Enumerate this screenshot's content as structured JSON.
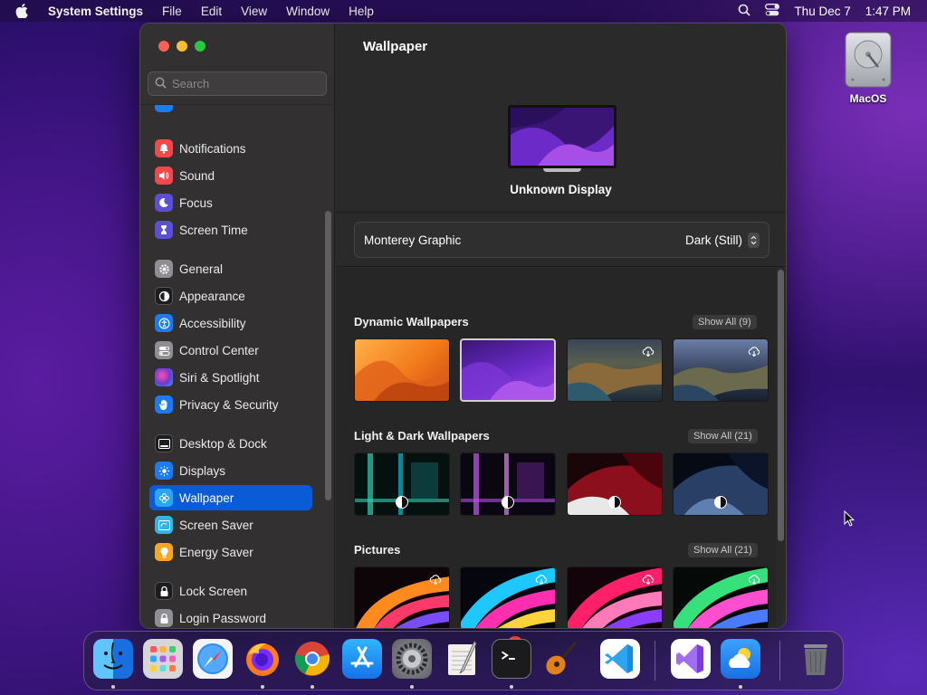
{
  "menubar": {
    "app_name": "System Settings",
    "menus": [
      "File",
      "Edit",
      "View",
      "Window",
      "Help"
    ],
    "date": "Thu Dec 7",
    "time": "1:47 PM"
  },
  "desktop": {
    "icons": [
      {
        "label": "MacOS",
        "icon": "hard-drive-icon"
      }
    ]
  },
  "window": {
    "search_placeholder": "Search",
    "sidebar": [
      {
        "label": "Notifications",
        "icon": "bell-icon",
        "color": "#f2474b"
      },
      {
        "label": "Sound",
        "icon": "speaker-icon",
        "color": "#f2474b"
      },
      {
        "label": "Focus",
        "icon": "moon-icon",
        "color": "#5a4fd6"
      },
      {
        "label": "Screen Time",
        "icon": "hourglass-icon",
        "color": "#5a4fd6"
      },
      {
        "label": "General",
        "icon": "gear-icon",
        "color": "#8e8e93"
      },
      {
        "label": "Appearance",
        "icon": "circle-half-icon",
        "color": "#1d1d1f"
      },
      {
        "label": "Accessibility",
        "icon": "accessibility-icon",
        "color": "#1a7bf2"
      },
      {
        "label": "Control Center",
        "icon": "toggles-icon",
        "color": "#8e8e93"
      },
      {
        "label": "Siri & Spotlight",
        "icon": "siri-icon",
        "color": "#b83ad9"
      },
      {
        "label": "Privacy & Security",
        "icon": "hand-icon",
        "color": "#1a7bf2"
      },
      {
        "label": "Desktop & Dock",
        "icon": "dock-icon",
        "color": "#1d1d1f"
      },
      {
        "label": "Displays",
        "icon": "sun-icon",
        "color": "#1a7bf2"
      },
      {
        "label": "Wallpaper",
        "icon": "flower-icon",
        "color": "#2aa6f5",
        "selected": true
      },
      {
        "label": "Screen Saver",
        "icon": "screensaver-icon",
        "color": "#32b4e8"
      },
      {
        "label": "Energy Saver",
        "icon": "bulb-icon",
        "color": "#f5a623"
      },
      {
        "label": "Lock Screen",
        "icon": "lock-icon",
        "color": "#1d1d1f"
      },
      {
        "label": "Login Password",
        "icon": "padlock-icon",
        "color": "#8e8e93"
      }
    ],
    "main": {
      "title": "Wallpaper",
      "display_name": "Unknown Display",
      "wallpaper_name": "Monterey Graphic",
      "appearance_value": "Dark (Still)",
      "sections": [
        {
          "title": "Dynamic Wallpapers",
          "show_all": "Show All (9)"
        },
        {
          "title": "Light & Dark Wallpapers",
          "show_all": "Show All (21)"
        },
        {
          "title": "Pictures",
          "show_all": "Show All (21)"
        }
      ]
    }
  },
  "dock": {
    "apps": [
      {
        "name": "Finder",
        "icon": "finder-icon",
        "running": true
      },
      {
        "name": "Launchpad",
        "icon": "launchpad-icon",
        "running": false
      },
      {
        "name": "Safari",
        "icon": "safari-icon",
        "running": false
      },
      {
        "name": "Firefox",
        "icon": "firefox-icon",
        "running": true
      },
      {
        "name": "Chrome",
        "icon": "chrome-icon",
        "running": true
      },
      {
        "name": "App Store",
        "icon": "app-store-icon",
        "running": false
      },
      {
        "name": "System Settings",
        "icon": "gear-icon",
        "running": true,
        "badge": "1"
      },
      {
        "name": "TextEdit",
        "icon": "notepad-icon",
        "running": false
      },
      {
        "name": "Terminal",
        "icon": "terminal-icon",
        "running": true
      },
      {
        "name": "GarageBand",
        "icon": "guitar-icon",
        "running": false
      },
      {
        "name": "VS Code",
        "icon": "vscode-icon",
        "running": false
      },
      {
        "name": "Visual Studio",
        "icon": "visual-studio-icon",
        "running": false
      },
      {
        "name": "Weather",
        "icon": "weather-icon",
        "running": true
      },
      {
        "name": "Trash",
        "icon": "trash-icon",
        "running": false
      }
    ]
  }
}
